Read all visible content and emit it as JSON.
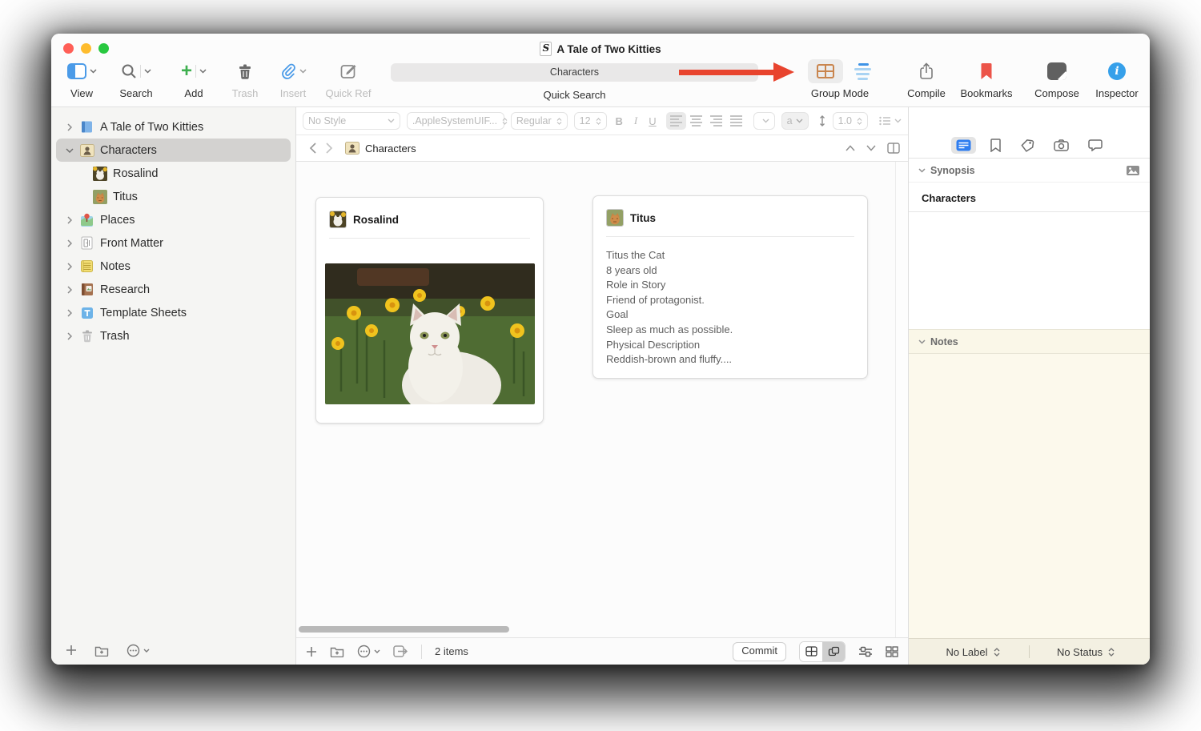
{
  "window_title": "A Tale of Two Kitties",
  "toolbar": {
    "view": "View",
    "search": "Search",
    "add": "Add",
    "trash": "Trash",
    "insert": "Insert",
    "quick_ref": "Quick Ref",
    "quick_search_value": "Characters",
    "quick_search_label": "Quick Search",
    "group_mode": "Group Mode",
    "compile": "Compile",
    "bookmarks": "Bookmarks",
    "compose": "Compose",
    "inspector": "Inspector"
  },
  "format_bar": {
    "style": "No Style",
    "font": ".AppleSystemUIF...",
    "variant": "Regular",
    "size": "12",
    "bold": "B",
    "italic": "I",
    "underline": "U",
    "highlight": "a",
    "line_spacing": "1.0"
  },
  "binder": {
    "items": [
      {
        "label": "A Tale of Two Kitties",
        "icon": "book-icon",
        "level": 0,
        "chevron": "right",
        "selected": false
      },
      {
        "label": "Characters",
        "icon": "character-card-icon",
        "level": 0,
        "chevron": "down",
        "selected": true
      },
      {
        "label": "Rosalind",
        "icon": "white-cat-thumb-icon",
        "level": 1,
        "chevron": "none",
        "selected": false
      },
      {
        "label": "Titus",
        "icon": "tabby-cat-thumb-icon",
        "level": 1,
        "chevron": "none",
        "selected": false
      },
      {
        "label": "Places",
        "icon": "map-pin-icon",
        "level": 0,
        "chevron": "right",
        "selected": false
      },
      {
        "label": "Front Matter",
        "icon": "front-matter-icon",
        "level": 0,
        "chevron": "right",
        "selected": false
      },
      {
        "label": "Notes",
        "icon": "notepad-icon",
        "level": 0,
        "chevron": "right",
        "selected": false
      },
      {
        "label": "Research",
        "icon": "research-book-icon",
        "level": 0,
        "chevron": "right",
        "selected": false
      },
      {
        "label": "Template Sheets",
        "icon": "template-icon",
        "level": 0,
        "chevron": "right",
        "selected": false
      },
      {
        "label": "Trash",
        "icon": "trash-can-icon",
        "level": 0,
        "chevron": "right",
        "selected": false
      }
    ]
  },
  "editor": {
    "nav_title": "Characters",
    "cards": [
      {
        "title": "Rosalind",
        "content": "photo of white cat among daffodils"
      },
      {
        "title": "Titus",
        "lines": [
          "Titus the Cat",
          "8 years old",
          "Role in Story",
          "Friend of protagonist.",
          "Goal",
          "Sleep as much as possible.",
          "Physical Description",
          "Reddish-brown and fluffy...."
        ]
      }
    ],
    "footer": {
      "count": "2 items",
      "commit": "Commit"
    }
  },
  "inspector": {
    "synopsis_label": "Synopsis",
    "synopsis_text": "Characters",
    "notes_label": "Notes",
    "label_dropdown": "No Label",
    "status_dropdown": "No Status"
  },
  "colors": {
    "corkboard_accent": "#c9854e",
    "outline_accent": "#3e93e6",
    "arrow_red": "#e8442e",
    "bookmark_red": "#ec5449",
    "inspector_blue": "#36a0ea",
    "add_green": "#3eaf4f",
    "notes_cream": "#fcf9ec"
  }
}
